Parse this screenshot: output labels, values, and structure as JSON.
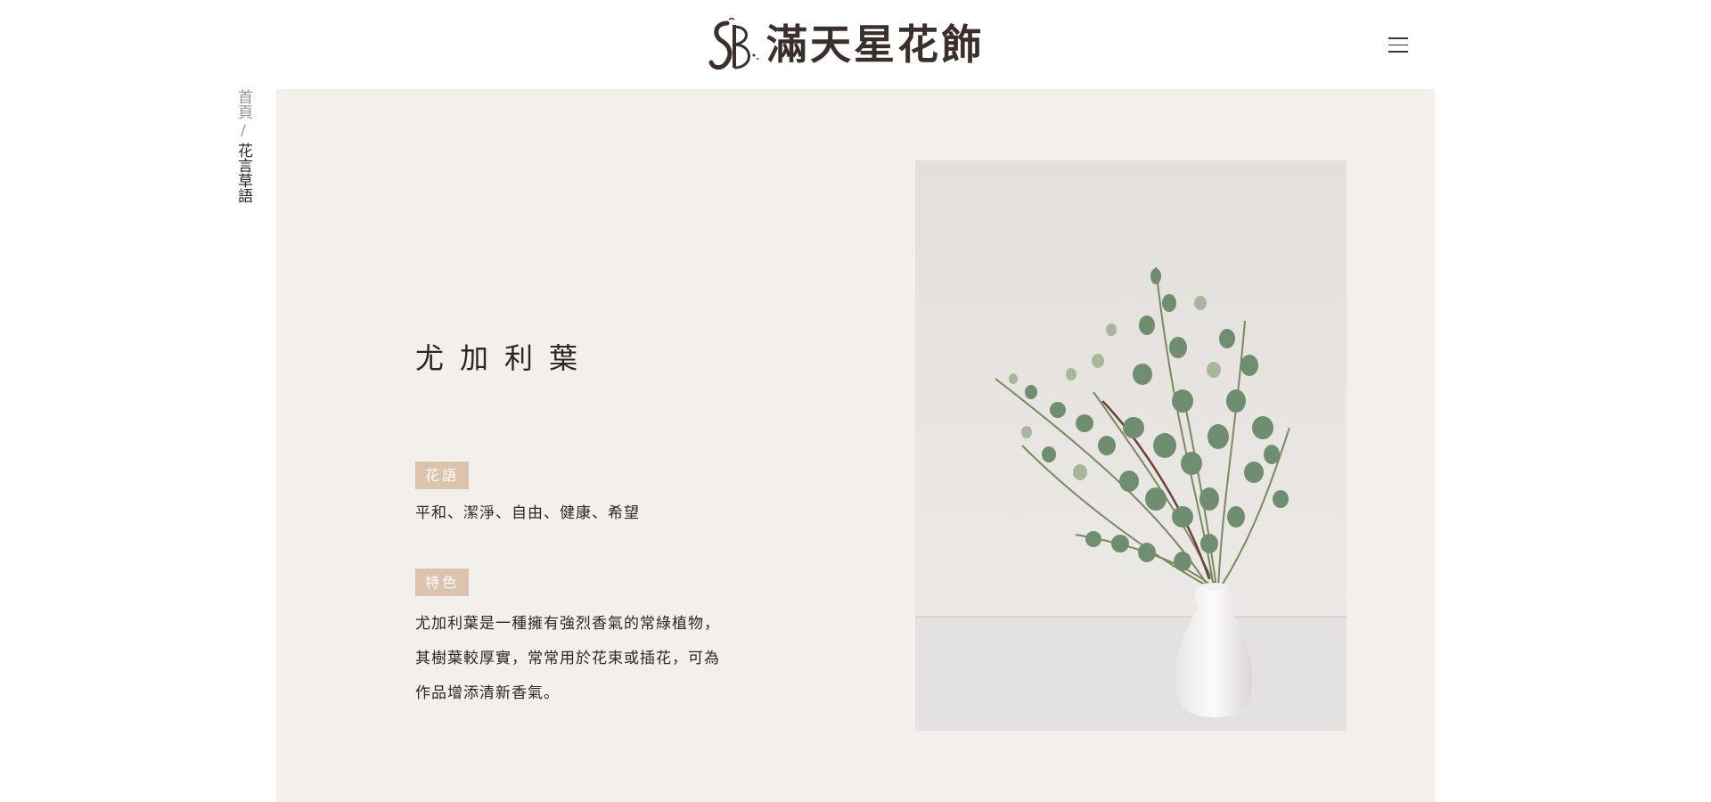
{
  "header": {
    "logo_text": "滿天星花飾",
    "logo_mark_alt": "SB",
    "menu_icon": "hamburger-menu-icon"
  },
  "breadcrumb": {
    "home": "首頁",
    "separator": "/",
    "current": "花言草語"
  },
  "flower": {
    "name": "尤加利葉",
    "meaning_label": "花語",
    "meaning": "平和、潔淨、自由、健康、希望",
    "feature_label": "特色",
    "feature_lines": [
      "尤加利葉是一種擁有強烈香氣的常綠植物，",
      "其樹葉較厚實，常常用於花束或插花，可為",
      "作品增添清新香氣。"
    ]
  },
  "colors": {
    "panel_bg": "#f3efeb",
    "tag_bg": "#dcc3ad",
    "logo_accent": "#d98b7b",
    "text": "#2e2622"
  }
}
